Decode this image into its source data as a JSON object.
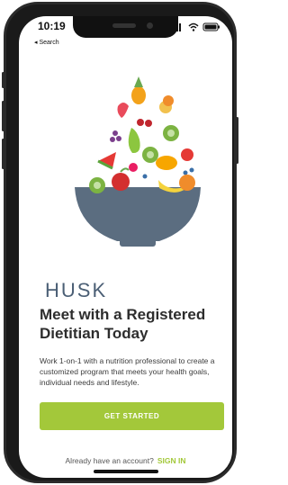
{
  "status_bar": {
    "time": "10:19",
    "back_label": "◂ Search"
  },
  "brand": {
    "logo_text": "HUSK",
    "accent": "#a3c83a",
    "logo_color": "#4b5f75"
  },
  "hero": {
    "title": "Meet with a Registered Dietitian Today",
    "description": "Work 1-on-1 with a nutrition professional to create a customized program that meets your health goals, individual needs and lifestyle."
  },
  "actions": {
    "primary_label": "GET STARTED",
    "account_prompt": "Already have an account?",
    "signin_label": "SIGN IN"
  },
  "icons": {
    "illustration": "fruit-bowl-illustration",
    "signal": "signal-icon",
    "wifi": "wifi-icon",
    "battery": "battery-icon"
  }
}
